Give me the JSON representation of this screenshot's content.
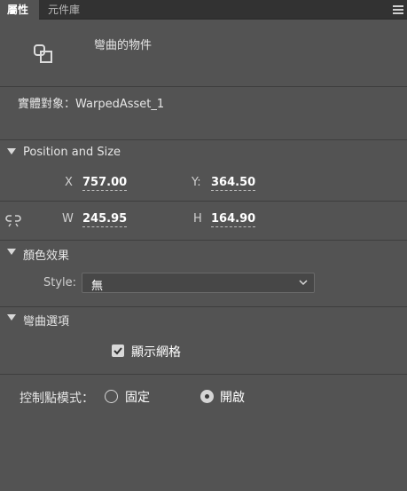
{
  "tabs": [
    {
      "label": "屬性",
      "active": true
    },
    {
      "label": "元件庫",
      "active": false
    }
  ],
  "panel_menu_icon": "hamburger-menu-icon",
  "object": {
    "icon": "warp-object-icon",
    "name": "彎曲的物件"
  },
  "instance": {
    "label": "實體對象：",
    "value": "WarpedAsset_1"
  },
  "position_size": {
    "title": "Position and Size",
    "x_label": "X",
    "x_value": "757.00",
    "y_label": "Y:",
    "y_value": "364.50",
    "w_label": "W",
    "w_value": "245.95",
    "h_label": "H",
    "h_value": "164.90",
    "link_icon": "link-proportions-icon"
  },
  "color_effect": {
    "title": "顏色效果",
    "style_label": "Style:",
    "style_value": "無"
  },
  "warp_options": {
    "title": "彎曲選項",
    "show_mesh_label": "顯示網格",
    "show_mesh_checked": true,
    "control_mode_label": "控制點模式：",
    "option_fixed": "固定",
    "option_open": "開啟",
    "selected": "開啟"
  },
  "colors": {
    "panel_bg": "#535353",
    "tabbar_bg": "#323232",
    "input_bg": "#474747",
    "text": "#e6e6e6"
  }
}
